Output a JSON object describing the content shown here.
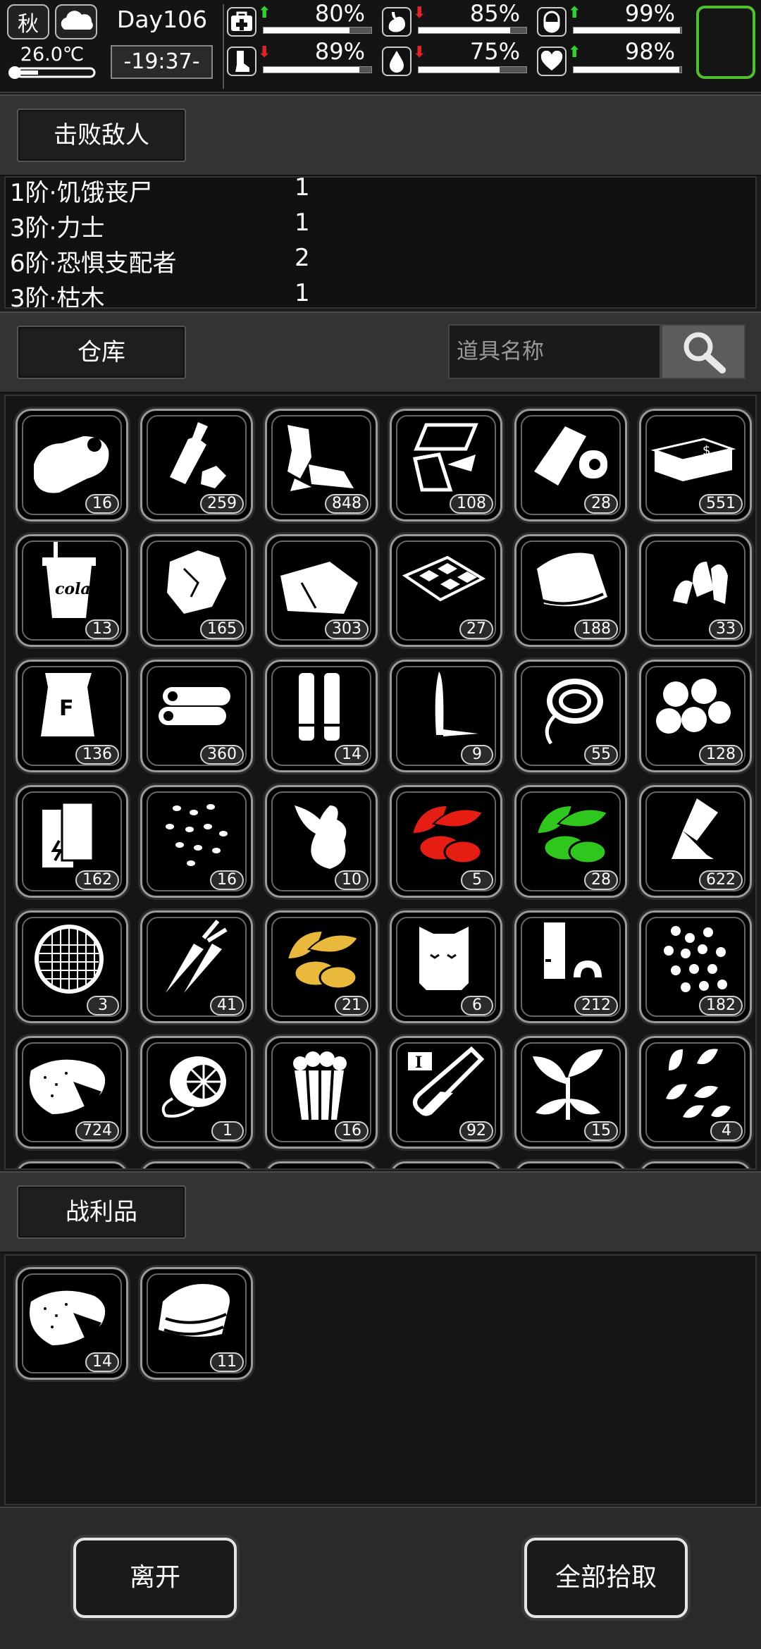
{
  "status": {
    "season": "秋",
    "weather_icon": "cloud-icon",
    "temperature": "26.0℃",
    "day": "Day106",
    "clock": "-19:37-",
    "stats": [
      {
        "name": "health",
        "icon": "medkit-icon",
        "trend": "up",
        "value": "80%",
        "level": 0.8
      },
      {
        "name": "hunger",
        "icon": "stomach-icon",
        "trend": "down",
        "value": "85%",
        "level": 0.85
      },
      {
        "name": "medicine",
        "icon": "pill-icon",
        "trend": "up",
        "value": "99%",
        "level": 0.99
      },
      {
        "name": "stamina",
        "icon": "leg-icon",
        "trend": "down",
        "value": "89%",
        "level": 0.89
      },
      {
        "name": "thirst",
        "icon": "water-drop-icon",
        "trend": "down",
        "value": "75%",
        "level": 0.75
      },
      {
        "name": "mood",
        "icon": "heart-icon",
        "trend": "up",
        "value": "98%",
        "level": 0.98
      }
    ]
  },
  "defeated": {
    "label": "击败敌人",
    "rows": [
      {
        "name": "1阶·饥饿丧尸",
        "count": "1"
      },
      {
        "name": "3阶·力士",
        "count": "1"
      },
      {
        "name": "6阶·恐惧支配者",
        "count": "2"
      },
      {
        "name": "3阶·枯木",
        "count": "1"
      }
    ]
  },
  "warehouse": {
    "label": "仓库",
    "search_placeholder": "道具名称",
    "items": [
      {
        "icon": "cloth-sack-icon",
        "count": "16"
      },
      {
        "icon": "plastic-bottle-icon",
        "count": "259"
      },
      {
        "icon": "scrap-metal-icon",
        "count": "848"
      },
      {
        "icon": "glass-shards-icon",
        "count": "108"
      },
      {
        "icon": "bandage-roll-icon",
        "count": "28"
      },
      {
        "icon": "cash-stack-icon",
        "count": "551"
      },
      {
        "icon": "cola-cup-icon",
        "count": "13",
        "text": "cola"
      },
      {
        "icon": "crumpled-paper-icon",
        "count": "165"
      },
      {
        "icon": "fabric-sheet-icon",
        "count": "303"
      },
      {
        "icon": "cracker-tray-icon",
        "count": "27"
      },
      {
        "icon": "towel-icon",
        "count": "188"
      },
      {
        "icon": "bullets-icon",
        "count": "33"
      },
      {
        "icon": "flour-bag-icon",
        "count": "136",
        "text": "F"
      },
      {
        "icon": "logs-icon",
        "count": "360"
      },
      {
        "icon": "cartridges-icon",
        "count": "14"
      },
      {
        "icon": "knife-blade-icon",
        "count": "9"
      },
      {
        "icon": "rope-coil-icon",
        "count": "55"
      },
      {
        "icon": "cotton-balls-icon",
        "count": "128"
      },
      {
        "icon": "battery-icon",
        "count": "162"
      },
      {
        "icon": "seeds-icon",
        "count": "16"
      },
      {
        "icon": "ginger-root-icon",
        "count": "10"
      },
      {
        "icon": "red-herb-icon",
        "count": "5",
        "color": "#e61d12"
      },
      {
        "icon": "green-herb-icon",
        "count": "28",
        "color": "#2fc71d"
      },
      {
        "icon": "glue-tube-icon",
        "count": "622"
      },
      {
        "icon": "filter-mesh-icon",
        "count": "3"
      },
      {
        "icon": "carrots-icon",
        "count": "41"
      },
      {
        "icon": "yellow-herb-icon",
        "count": "21",
        "color": "#e8b93a"
      },
      {
        "icon": "fur-pelt-icon",
        "count": "6"
      },
      {
        "icon": "metal-parts-icon",
        "count": "212"
      },
      {
        "icon": "beans-icon",
        "count": "182"
      },
      {
        "icon": "sweet-potato-icon",
        "count": "724"
      },
      {
        "icon": "lemon-icon",
        "count": "1"
      },
      {
        "icon": "popcorn-icon",
        "count": "16"
      },
      {
        "icon": "test-tube-icon",
        "count": "92",
        "text": "I"
      },
      {
        "icon": "leafy-plant-icon",
        "count": "15"
      },
      {
        "icon": "leaves-icon",
        "count": "4"
      }
    ]
  },
  "loot": {
    "label": "战利品",
    "items": [
      {
        "icon": "sweet-potato-icon",
        "count": "14"
      },
      {
        "icon": "folded-cloth-icon",
        "count": "11"
      }
    ]
  },
  "actions": {
    "leave": "离开",
    "take_all": "全部拾取"
  }
}
